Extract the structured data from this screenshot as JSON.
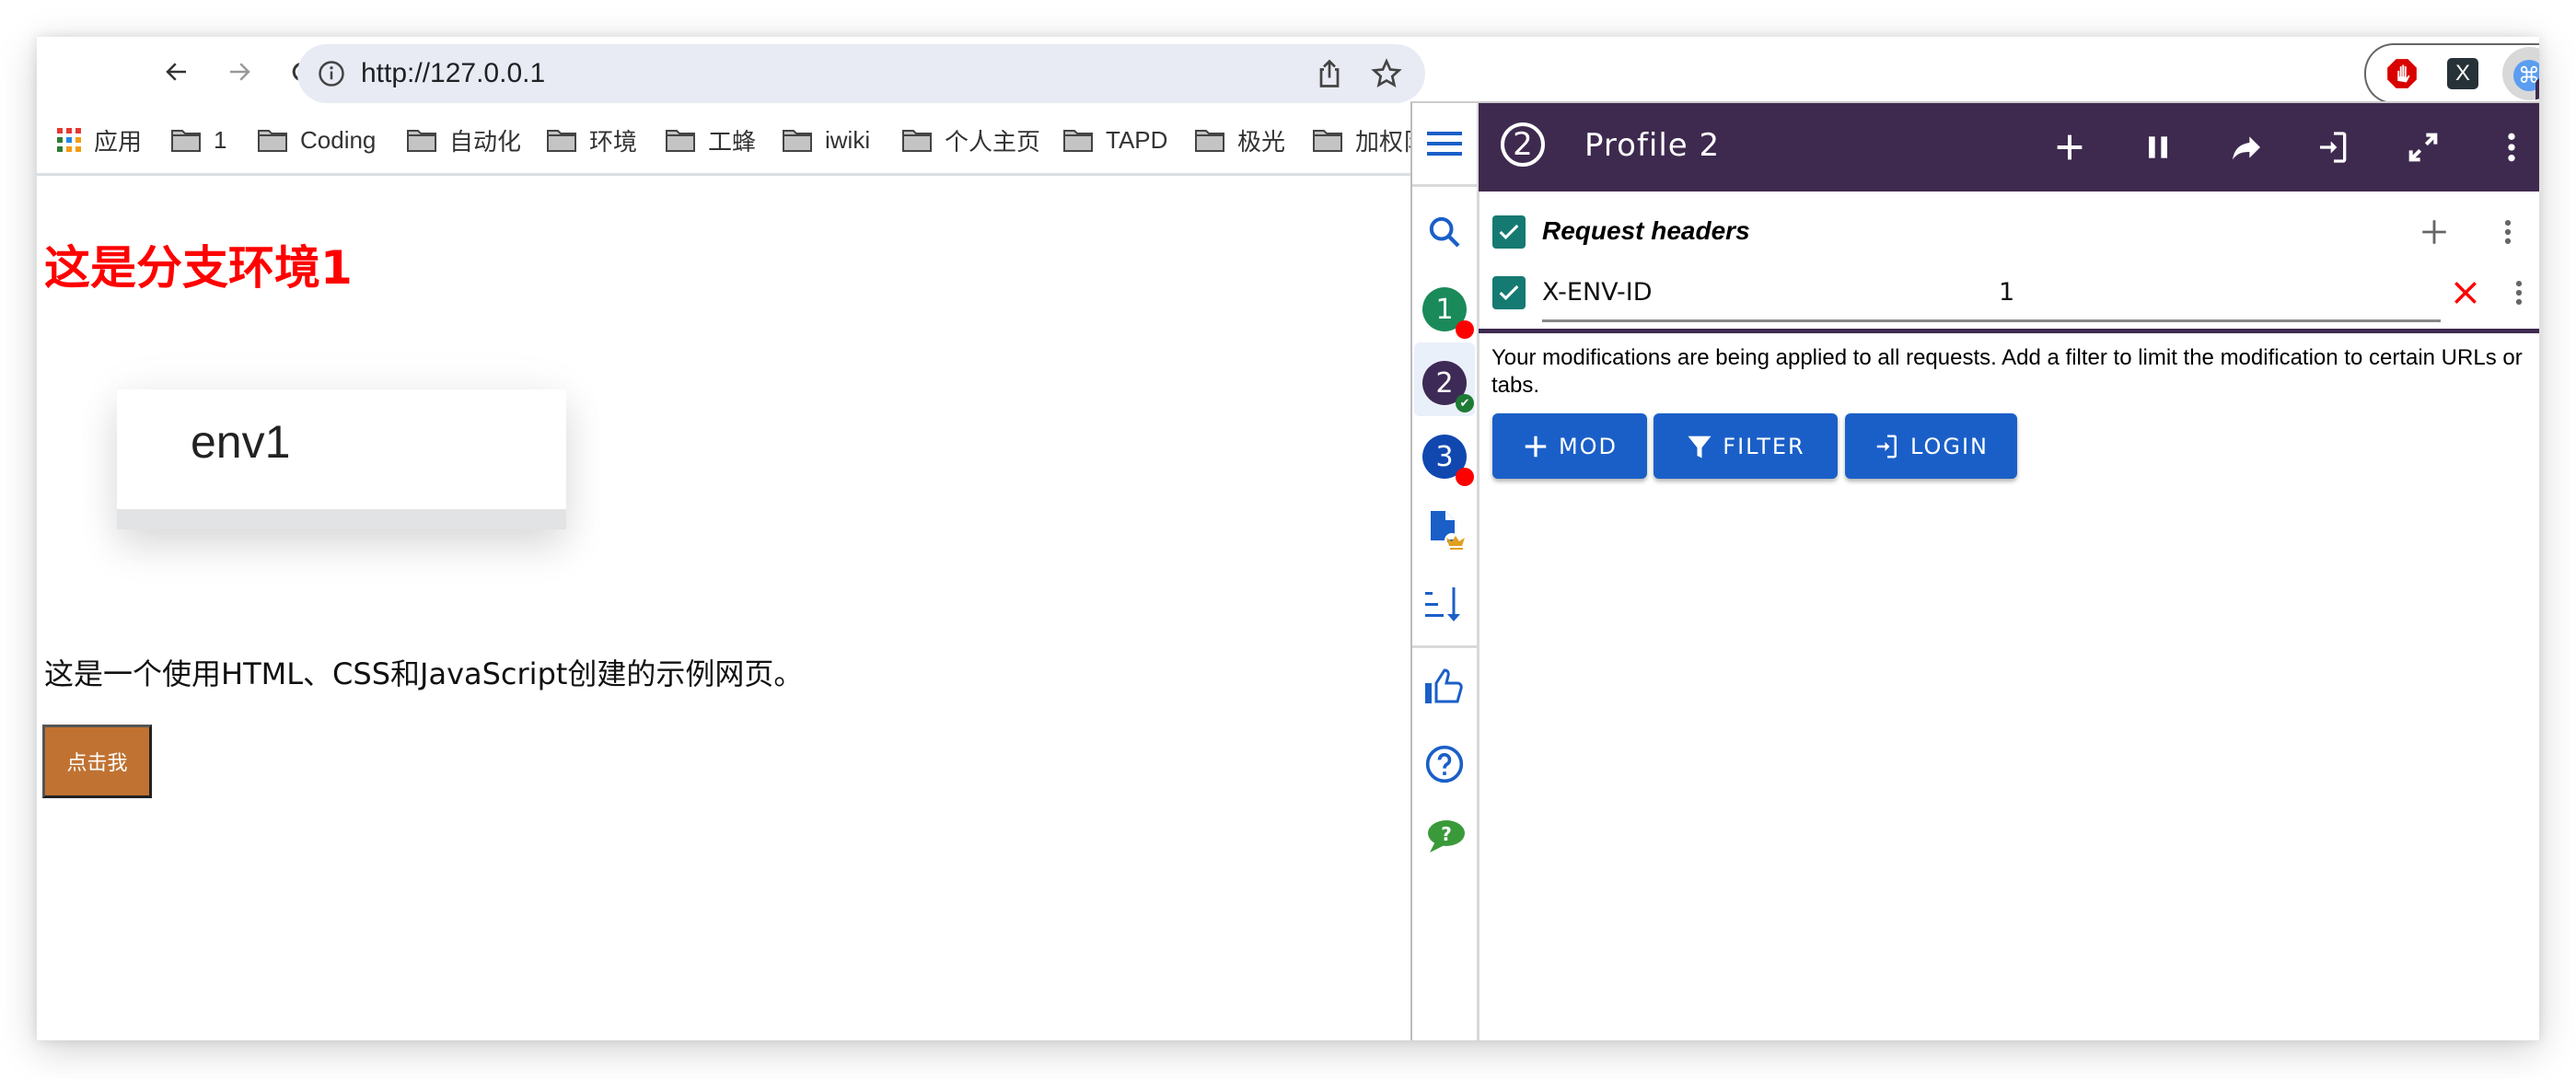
{
  "browser": {
    "url": "http://127.0.0.1",
    "nav": {
      "back": "back-icon",
      "forward": "forward-icon",
      "reload": "reload-icon",
      "home": "home-icon"
    },
    "bookmarks": [
      {
        "label": "应用",
        "icon": "apps-icon"
      },
      {
        "label": "1",
        "icon": "folder-icon"
      },
      {
        "label": "Coding",
        "icon": "folder-icon"
      },
      {
        "label": "自动化",
        "icon": "folder-icon"
      },
      {
        "label": "环境",
        "icon": "folder-icon"
      },
      {
        "label": "工蜂",
        "icon": "folder-icon"
      },
      {
        "label": "iwiki",
        "icon": "folder-icon"
      },
      {
        "label": "个人主页",
        "icon": "folder-icon"
      },
      {
        "label": "TAPD",
        "icon": "folder-icon"
      },
      {
        "label": "极光",
        "icon": "folder-icon"
      },
      {
        "label": "加权阝",
        "icon": "folder-icon"
      }
    ],
    "extensions": {
      "x_label": "X",
      "cmd_label": "⌘"
    }
  },
  "page": {
    "heading": "这是分支环境1",
    "card_text": "env1",
    "paragraph": "这是一个使用HTML、CSS和JavaScript创建的示例网页。",
    "button_label": "点击我",
    "colors": {
      "heading": "#ff0000",
      "button": "#c07232"
    }
  },
  "extension": {
    "profile_number": "2",
    "profile_title": "Profile 2",
    "header_color": "#3e2a4f",
    "sidebar": {
      "profiles": [
        {
          "number": "1",
          "color": "#1b8a5a",
          "status": "inactive"
        },
        {
          "number": "2",
          "color": "#3e2a56",
          "status": "active",
          "selected": true
        },
        {
          "number": "3",
          "color": "#1148b0",
          "status": "inactive"
        }
      ]
    },
    "section": {
      "title": "Request headers",
      "enabled": true
    },
    "headers": [
      {
        "name": "X-ENV-ID",
        "value": "1",
        "enabled": true
      }
    ],
    "notice": "Your modifications are being applied to all requests. Add a filter to limit the modification to certain URLs or tabs.",
    "actions": [
      {
        "label": "MOD",
        "icon": "plus-icon"
      },
      {
        "label": "FILTER",
        "icon": "filter-icon"
      },
      {
        "label": "LOGIN",
        "icon": "login-icon"
      }
    ]
  }
}
